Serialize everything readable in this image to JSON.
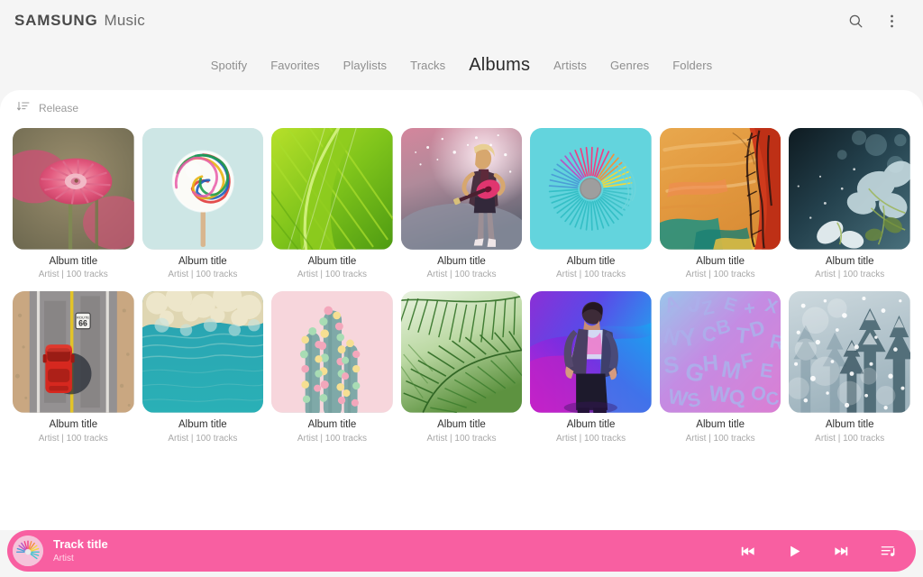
{
  "app": {
    "brand_samsung": "SAMSUNG",
    "brand_music": "Music"
  },
  "header": {
    "search_icon": "search-icon",
    "more_icon": "more-vertical-icon"
  },
  "tabs": [
    {
      "label": "Spotify",
      "active": false
    },
    {
      "label": "Favorites",
      "active": false
    },
    {
      "label": "Playlists",
      "active": false
    },
    {
      "label": "Tracks",
      "active": false
    },
    {
      "label": "Albums",
      "active": true
    },
    {
      "label": "Artists",
      "active": false
    },
    {
      "label": "Genres",
      "active": false
    },
    {
      "label": "Folders",
      "active": false
    }
  ],
  "sort": {
    "icon": "sort-descending-icon",
    "label": "Release"
  },
  "albums": [
    {
      "title": "Album title",
      "subtitle": "Artist | 100 tracks",
      "art": "pink-chrysanthemum-flower"
    },
    {
      "title": "Album title",
      "subtitle": "Artist | 100 tracks",
      "art": "rainbow-swirl-lollipop"
    },
    {
      "title": "Album title",
      "subtitle": "Artist | 100 tracks",
      "art": "green-leaf-closeup"
    },
    {
      "title": "Album title",
      "subtitle": "Artist | 100 tracks",
      "art": "guitarist-on-stage"
    },
    {
      "title": "Album title",
      "subtitle": "Artist | 100 tracks",
      "art": "rainbow-slinky-spiral"
    },
    {
      "title": "Album title",
      "subtitle": "Artist | 100 tracks",
      "art": "orange-abstract-paint"
    },
    {
      "title": "Album title",
      "subtitle": "Artist | 100 tracks",
      "art": "frosted-winter-leaves"
    },
    {
      "title": "Album title",
      "subtitle": "Artist | 100 tracks",
      "art": "red-car-route-66"
    },
    {
      "title": "Album title",
      "subtitle": "Artist | 100 tracks",
      "art": "turquoise-ocean-foam"
    },
    {
      "title": "Album title",
      "subtitle": "Artist | 100 tracks",
      "art": "pastel-pompom-cactus"
    },
    {
      "title": "Album title",
      "subtitle": "Artist | 100 tracks",
      "art": "green-palm-fronds"
    },
    {
      "title": "Album title",
      "subtitle": "Artist | 100 tracks",
      "art": "neon-portrait-person"
    },
    {
      "title": "Album title",
      "subtitle": "Artist | 100 tracks",
      "art": "3d-letters-gradient"
    },
    {
      "title": "Album title",
      "subtitle": "Artist | 100 tracks",
      "art": "snowy-pine-forest"
    }
  ],
  "player": {
    "track_title": "Track title",
    "artist": "Artist",
    "thumb_art": "rainbow-slinky-spiral",
    "previous_icon": "skip-previous-icon",
    "play_icon": "play-icon",
    "next_icon": "skip-next-icon",
    "queue_icon": "queue-music-icon"
  },
  "colors": {
    "accent_pink": "#f85fa1",
    "page_bg": "#f5f5f5",
    "panel_bg": "#ffffff",
    "tab_inactive": "#8e8e8e",
    "tab_active": "#2b2b2b",
    "album_title": "#303030",
    "album_subtitle": "#a8a8a8"
  }
}
